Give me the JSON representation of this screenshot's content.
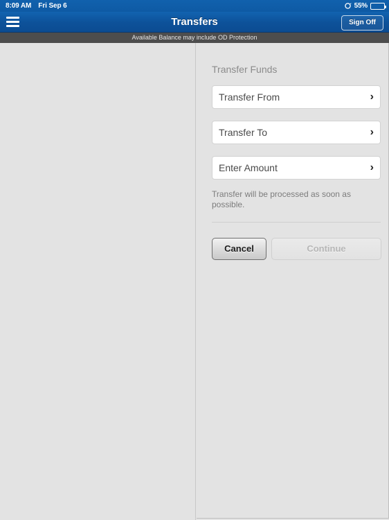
{
  "statusbar": {
    "time": "8:09 AM",
    "date": "Fri Sep 6",
    "rotation_lock_icon": "rotation-lock-icon",
    "battery_percent": "55%",
    "battery_level": 55
  },
  "navbar": {
    "menu_icon": "hamburger-menu-icon",
    "title": "Transfers",
    "sign_off_label": "Sign Off"
  },
  "notice": {
    "text": "Available Balance may include OD Protection"
  },
  "panel": {
    "section_title": "Transfer Funds",
    "fields": [
      {
        "label": "Transfer From",
        "chevron": "›"
      },
      {
        "label": "Transfer To",
        "chevron": "›"
      },
      {
        "label": "Enter Amount",
        "chevron": "›"
      }
    ],
    "hint": "Transfer will be processed as soon as possible.",
    "buttons": {
      "cancel_label": "Cancel",
      "continue_label": "Continue",
      "continue_disabled": true
    }
  },
  "colors": {
    "nav_blue": "#0d5199",
    "status_blue": "#0e5aa4",
    "notice_gray": "#4d4d4d",
    "page_bg": "#e3e3e3",
    "field_bg": "#ffffff",
    "disabled_text": "#b6b6b6"
  }
}
